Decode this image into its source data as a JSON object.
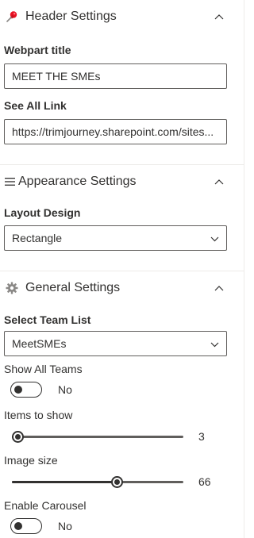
{
  "header_group": {
    "icon": "pin-icon",
    "title": "Header Settings",
    "webpart_title_label": "Webpart title",
    "webpart_title_value": "MEET THE SMEs",
    "see_all_label": "See All Link",
    "see_all_value": "https://trimjourney.sharepoint.com/sites/SPFx-Team/SitePages/MeetTheSMEs.aspx",
    "see_all_display": "https://trimjourney.sharepoint.com/sites..."
  },
  "appearance_group": {
    "icon": "hamburger-menu-icon",
    "title": "Appearance Settings",
    "layout_label": "Layout Design",
    "layout_value": "Rectangle"
  },
  "general_group": {
    "icon": "gear-icon",
    "title": "General Settings",
    "team_list_label": "Select Team List",
    "team_list_value": "MeetSMEs",
    "show_all_label": "Show All Teams",
    "show_all_state": "No",
    "items_label": "Items to show",
    "items_value": "3",
    "items_fill": 0.0,
    "image_label": "Image size",
    "image_value": "66",
    "image_fill": 0.62,
    "carousel_label": "Enable Carousel",
    "carousel_state": "No"
  },
  "colors": {
    "border": "#605e5c",
    "text": "#323130",
    "divider": "#edebe9",
    "pin_red": "#e81123"
  }
}
